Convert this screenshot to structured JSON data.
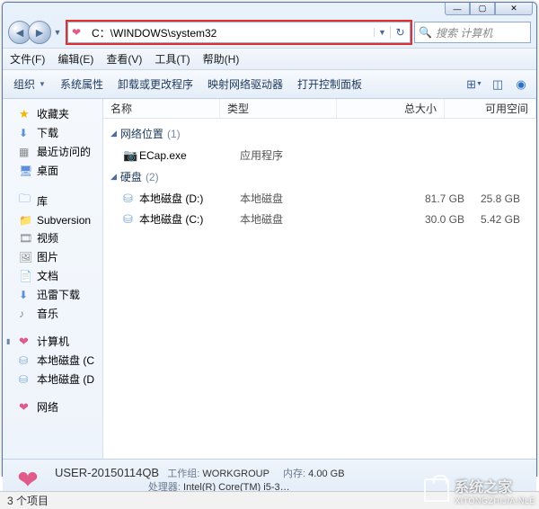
{
  "window_controls": {
    "min": "—",
    "max": "▢",
    "close": "✕"
  },
  "address": {
    "path": "C：\\WINDOWS\\system32",
    "icon": "❤"
  },
  "search": {
    "placeholder": "搜索 计算机",
    "icon": "🔍"
  },
  "menus": {
    "file": "文件(F)",
    "edit": "编辑(E)",
    "view": "查看(V)",
    "tools": "工具(T)",
    "help": "帮助(H)"
  },
  "toolbar": {
    "organize": "组织",
    "properties": "系统属性",
    "uninstall": "卸载或更改程序",
    "network": "映射网络驱动器",
    "control": "打开控制面板"
  },
  "sidebar": {
    "favorites": {
      "label": "收藏夹",
      "items": [
        {
          "icon": "⬇",
          "label": "下载",
          "color": "blue"
        },
        {
          "icon": "▦",
          "label": "最近访问的",
          "color": "gray"
        },
        {
          "icon": "🖥",
          "label": "桌面",
          "color": "blue"
        }
      ]
    },
    "libraries": {
      "label": "库",
      "items": [
        {
          "icon": "📁",
          "label": "Subversion",
          "color": "folder"
        },
        {
          "icon": "🎞",
          "label": "视频",
          "color": "gray"
        },
        {
          "icon": "🖼",
          "label": "图片",
          "color": "gray"
        },
        {
          "icon": "📄",
          "label": "文档",
          "color": "gray"
        },
        {
          "icon": "⬇",
          "label": "迅雷下载",
          "color": "blue"
        },
        {
          "icon": "♪",
          "label": "音乐",
          "color": "gray"
        }
      ]
    },
    "computer": {
      "label": "计算机",
      "items": [
        {
          "icon": "⛁",
          "label": "本地磁盘 (C",
          "color": "drive"
        },
        {
          "icon": "⛁",
          "label": "本地磁盘 (D",
          "color": "drive"
        }
      ]
    },
    "network": {
      "label": "网络"
    }
  },
  "columns": {
    "name": "名称",
    "type": "类型",
    "size": "总大小",
    "free": "可用空间"
  },
  "groups": [
    {
      "title": "网络位置",
      "count": "(1)",
      "rows": [
        {
          "icon": "📷",
          "iconClass": "cam",
          "name": "ECap.exe",
          "type": "应用程序",
          "size": "",
          "free": ""
        }
      ]
    },
    {
      "title": "硬盘",
      "count": "(2)",
      "rows": [
        {
          "icon": "⛁",
          "iconClass": "drive",
          "name": "本地磁盘 (D:)",
          "type": "本地磁盘",
          "size": "81.7 GB",
          "free": "25.8 GB"
        },
        {
          "icon": "⛁",
          "iconClass": "drive",
          "name": "本地磁盘 (C:)",
          "type": "本地磁盘",
          "size": "30.0 GB",
          "free": "5.42 GB"
        }
      ]
    }
  ],
  "details": {
    "name": "USER-20150114QB",
    "workgroup_label": "工作组:",
    "workgroup": "WORKGROUP",
    "mem_label": "内存:",
    "mem": "4.00 GB",
    "cpu_label": "处理器:",
    "cpu": "Intel(R) Core(TM) i5-3…"
  },
  "status": "3 个项目",
  "watermark": {
    "text": "系统之家",
    "url": "XITONGZHIJIA.NLE"
  }
}
